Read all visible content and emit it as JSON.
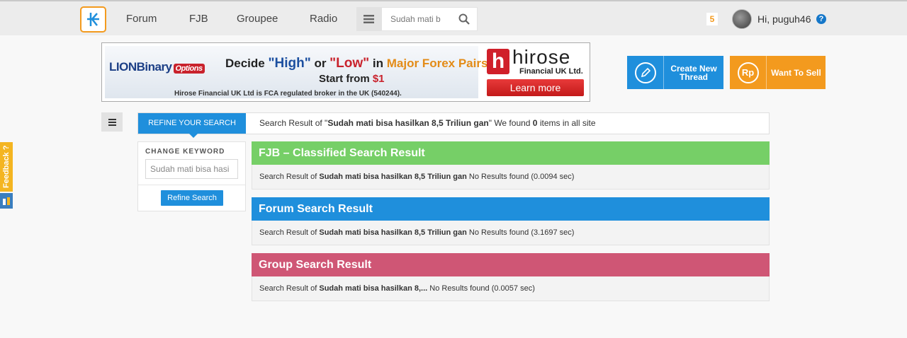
{
  "nav": {
    "items": [
      {
        "id": "forum",
        "label": "Forum"
      },
      {
        "id": "fjb",
        "label": "FJB"
      },
      {
        "id": "groupee",
        "label": "Groupee"
      },
      {
        "id": "radio",
        "label": "Radio"
      }
    ],
    "search_value": "Sudah mati b",
    "notif_count": "5",
    "greeting": "Hi, puguh46",
    "help": "?"
  },
  "banner": {
    "brand": "LIONBinary",
    "brand_tag": "Options",
    "headline_pre": "Decide ",
    "headline_high": "\"High\"",
    "headline_or": " or ",
    "headline_low": "\"Low\"",
    "headline_in": " in ",
    "headline_major": "Major Forex Pairs",
    "sub_pre": "Start from ",
    "sub_dollar": "$1",
    "footnote": "Hirose Financial UK Ltd is FCA regulated broker in the UK (540244).",
    "hirose_word": "hirose",
    "hirose_sub": "Financial UK Ltd.",
    "learn_more": "Learn more"
  },
  "actions": {
    "create_label": "Create New Thread",
    "sell_label": "Want To Sell",
    "sell_icon": "Rp"
  },
  "search": {
    "refine_tab": "REFINE YOUR SEARCH",
    "summary_pre": "Search Result of \"",
    "query": "Sudah mati bisa hasilkan 8,5 Triliun gan",
    "summary_mid": "\" We found ",
    "count": "0",
    "summary_post": " items in all site"
  },
  "refine_panel": {
    "label": "CHANGE KEYWORD",
    "keyword_value": "Sudah mati bisa hasi",
    "button": "Refine Search"
  },
  "sections": {
    "fjb": {
      "title": "FJB – Classified Search Result",
      "pre": "Search Result of ",
      "query": "Sudah mati bisa hasilkan 8,5 Triliun gan",
      "post": "  No Results found (0.0094 sec)"
    },
    "forum": {
      "title": "Forum Search Result",
      "pre": "Search Result of ",
      "query": "Sudah mati bisa hasilkan 8,5 Triliun gan",
      "post": " No Results found (3.1697 sec)"
    },
    "group": {
      "title": "Group Search Result",
      "pre": "Search Result of ",
      "query": "Sudah mati bisa hasilkan 8,...",
      "post": " No Results found (0.0057 sec)"
    }
  },
  "feedback": {
    "label": "Feedback ?"
  },
  "colors": {
    "accent_blue": "#1f8fdc",
    "accent_orange": "#f39a1e",
    "fjb_green": "#76cf67",
    "group_pink": "#cf5675"
  }
}
